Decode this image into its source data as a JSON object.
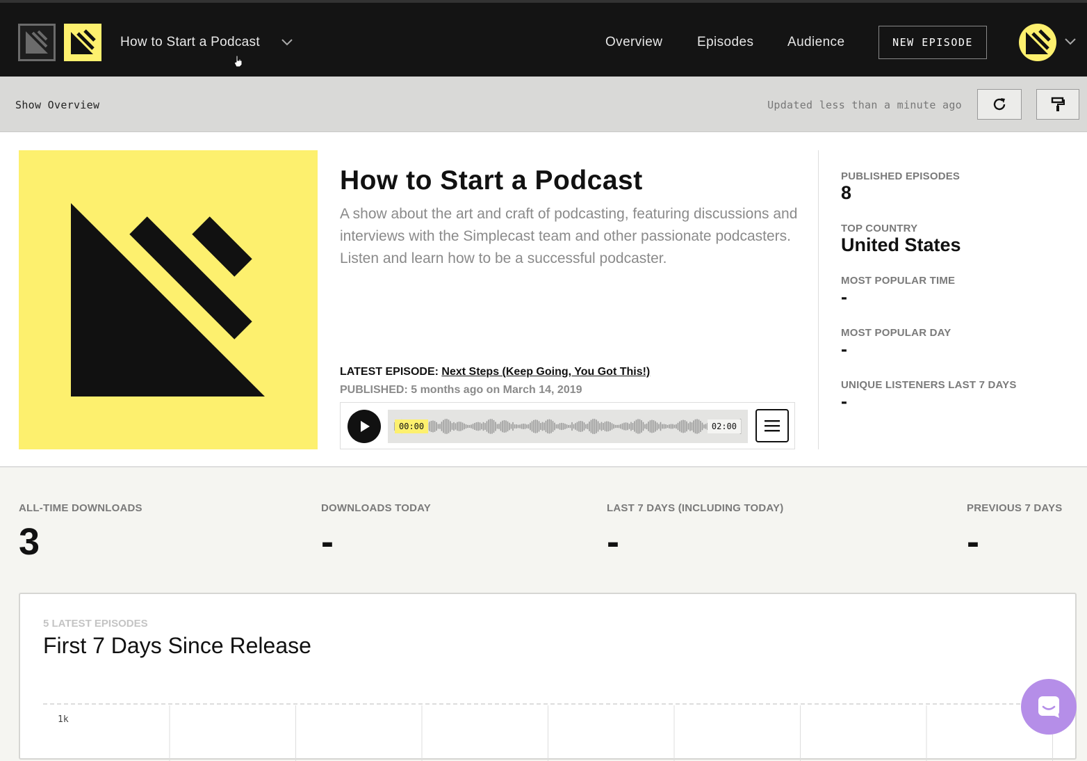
{
  "topbar": {
    "show_name": "How to Start a Podcast",
    "nav": [
      "Overview",
      "Episodes",
      "Audience"
    ],
    "new_episode_label": "NEW EPISODE"
  },
  "subbar": {
    "title": "Show Overview",
    "updated": "Updated less than a minute ago",
    "refresh_icon": "refresh-icon",
    "customize_icon": "paint-roller-icon"
  },
  "show": {
    "title": "How to Start a Podcast",
    "description": "A show about the art and craft of podcasting, featuring discussions and interviews with the Simplecast team and other passionate podcasters. Listen and learn how to be a successful podcaster.",
    "latest_label": "LATEST EPISODE:",
    "latest_title": "Next Steps (Keep Going, You Got This!)",
    "published": "PUBLISHED: 5 months ago on March 14, 2019",
    "player": {
      "time_start": "00:00",
      "time_end": "02:00"
    }
  },
  "stats": {
    "published_episodes_label": "PUBLISHED EPISODES",
    "published_episodes_value": "8",
    "top_country_label": "TOP COUNTRY",
    "top_country_value": "United States",
    "popular_time_label": "MOST POPULAR TIME",
    "popular_time_value": "-",
    "popular_day_label": "MOST POPULAR DAY",
    "popular_day_value": "-",
    "unique_listeners_label": "UNIQUE LISTENERS LAST 7 DAYS",
    "unique_listeners_value": "-"
  },
  "metrics": {
    "all_time_label": "ALL-TIME DOWNLOADS",
    "all_time_value": "3",
    "today_label": "DOWNLOADS TODAY",
    "today_value": "-",
    "last7_label": "LAST 7 DAYS (INCLUDING TODAY)",
    "last7_value": "-",
    "prev7_label": "PREVIOUS 7 DAYS",
    "prev7_value": "-"
  },
  "chart": {
    "kicker": "5 LATEST EPISODES",
    "title": "First 7 Days Since Release",
    "y_tick": "1k"
  },
  "colors": {
    "brand_yellow": "#fdf06e",
    "topbar": "#141414",
    "chat": "#b58ee8"
  }
}
